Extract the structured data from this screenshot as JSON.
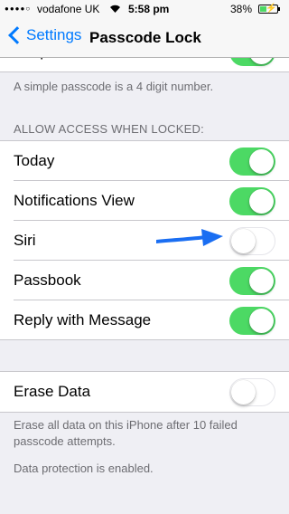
{
  "status_bar": {
    "signal": "●●●●○",
    "carrier": "vodafone UK",
    "time": "5:58 pm",
    "battery_percent": "38%",
    "battery_level": 0.38
  },
  "nav": {
    "back_label": "Settings",
    "title": "Passcode Lock"
  },
  "simple_passcode": {
    "label": "Simple Passcode",
    "on": true,
    "footer": "A simple passcode is a 4 digit number."
  },
  "locked_access": {
    "header": "ALLOW ACCESS WHEN LOCKED:",
    "items": [
      {
        "label": "Today",
        "on": true
      },
      {
        "label": "Notifications View",
        "on": true
      },
      {
        "label": "Siri",
        "on": false
      },
      {
        "label": "Passbook",
        "on": true
      },
      {
        "label": "Reply with Message",
        "on": true
      }
    ]
  },
  "erase": {
    "label": "Erase Data",
    "on": false,
    "footer": "Erase all data on this iPhone after 10 failed passcode attempts.",
    "footer2": "Data protection is enabled."
  },
  "colors": {
    "accent": "#007aff",
    "toggle_on": "#4cd964",
    "arrow": "#1a6ef2"
  }
}
